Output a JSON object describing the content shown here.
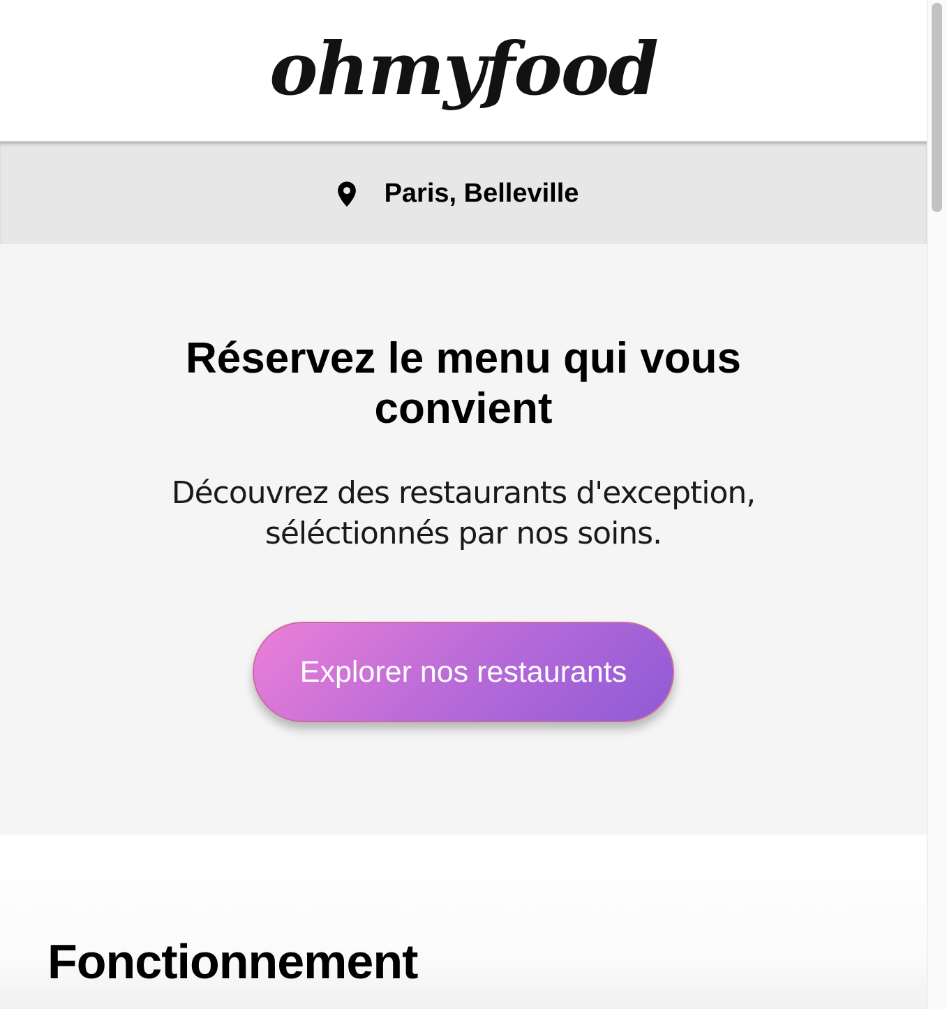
{
  "header": {
    "logo_text": "ohmyfood"
  },
  "location": {
    "icon": "map-pin-icon",
    "label": "Paris, Belleville"
  },
  "hero": {
    "title_line1": "Réservez le menu qui vous",
    "title_line2": "convient",
    "subtitle_line1": "Découvrez des restaurants d'exception,",
    "subtitle_line2": "séléctionnés par nos soins.",
    "cta_label": "Explorer nos restaurants"
  },
  "section": {
    "title": "Fonctionnement"
  },
  "colors": {
    "gradient_start": "#ec7fd8",
    "gradient_end": "#8f5ad6",
    "location_bar": "#e7e7e7",
    "hero_background": "#f5f5f5"
  }
}
